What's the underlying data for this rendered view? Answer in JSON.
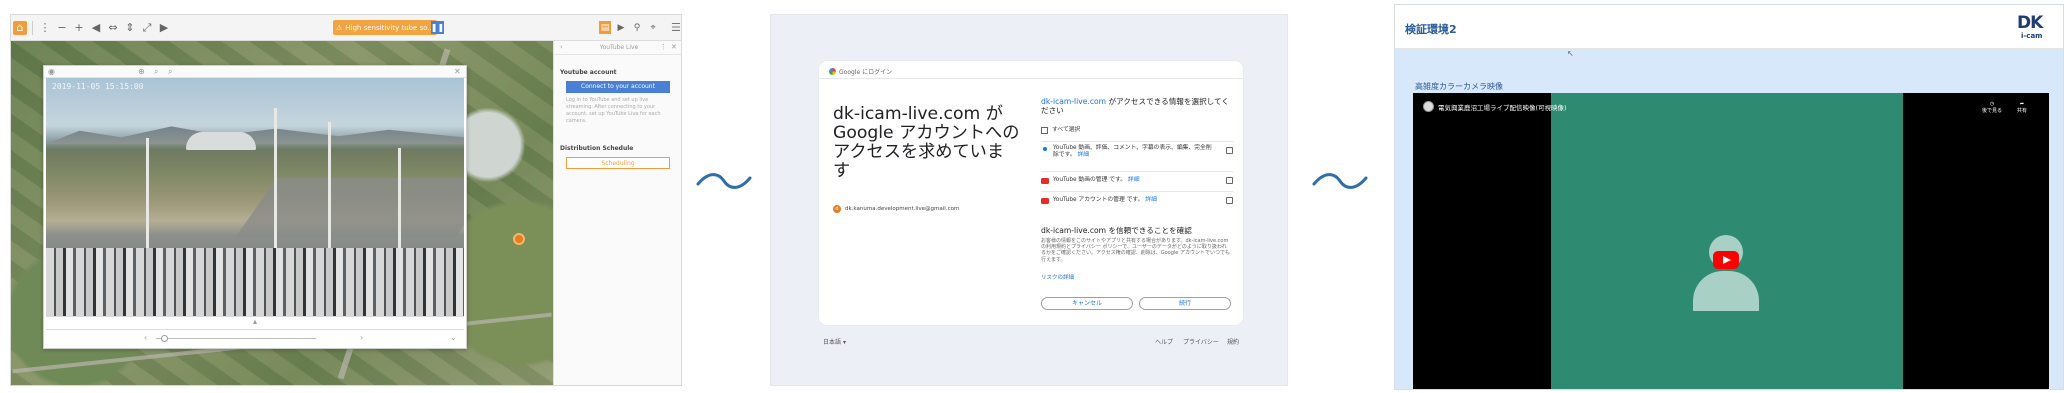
{
  "panel1": {
    "alert_text": "High sensitivity tube so...",
    "photo_timestamp": "2019-11-05 15:15:00",
    "sidebar": {
      "header": "YouTube Live",
      "youtube_account_label": "Youtube account",
      "connect_button": "Connect to your account",
      "description": "Log in to YouTube and set up live streaming. After connecting to your account, set up YouTube Live for each camera.",
      "distribution_label": "Distribution Schedule",
      "schedule_button": "Scheduling"
    },
    "colors": {
      "accent": "#f39c3c",
      "button_blue": "#4a7fd6"
    }
  },
  "panel2": {
    "header": "Google にログイン",
    "headline": "dk-icam-live.com が Google アカウントへのアクセスを求めています",
    "account_email": "dk.kanuma.development.live@gmail.com",
    "request_link": "dk-icam-live.com",
    "request_text": " がアクセスできる情報を選択してください",
    "select_all": "すべて選択",
    "items": [
      {
        "text": "YouTube 動画、評価、コメント、字幕の表示、編集、完全削除です。",
        "link": "詳細"
      },
      {
        "text": "YouTube 動画の管理 です。",
        "link": "詳細"
      },
      {
        "text": "YouTube アカウントの管理 です。",
        "link": "詳細"
      }
    ],
    "trust_title": "dk-icam-live.com を信頼できることを確認",
    "trust_body": "お客様の情報をこのサイトやアプリと共有する場合があります。dk-icam-live.com の利用規約とプライバシー ポリシーで、ユーザーのデータがどのように取り扱われるかをご確認ください。アクセス権の確認、削除は、Google アカウントでいつでも行えます。",
    "risk_link": "リスクの詳細",
    "cancel": "キャンセル",
    "continue": "続行",
    "footer": {
      "lang": "日本語",
      "help": "ヘルプ",
      "privacy": "プライバシー",
      "terms": "規約"
    },
    "colors": {
      "link": "#1a73e8",
      "youtube_red": "#e52d27"
    }
  },
  "panel3": {
    "page_title": "検証環境2",
    "logo_top": "DK",
    "logo_bottom": "i-cam",
    "caption": "高雑度カラーカメラ映像",
    "video_title": "電気興業鹿沼工場ライブ配信映像(可視映像)",
    "watch_later": "後で見る",
    "share": "共有",
    "colors": {
      "title": "#2a5b9a",
      "background": "#d7e8fa",
      "video_bg": "#2e8a70"
    }
  }
}
